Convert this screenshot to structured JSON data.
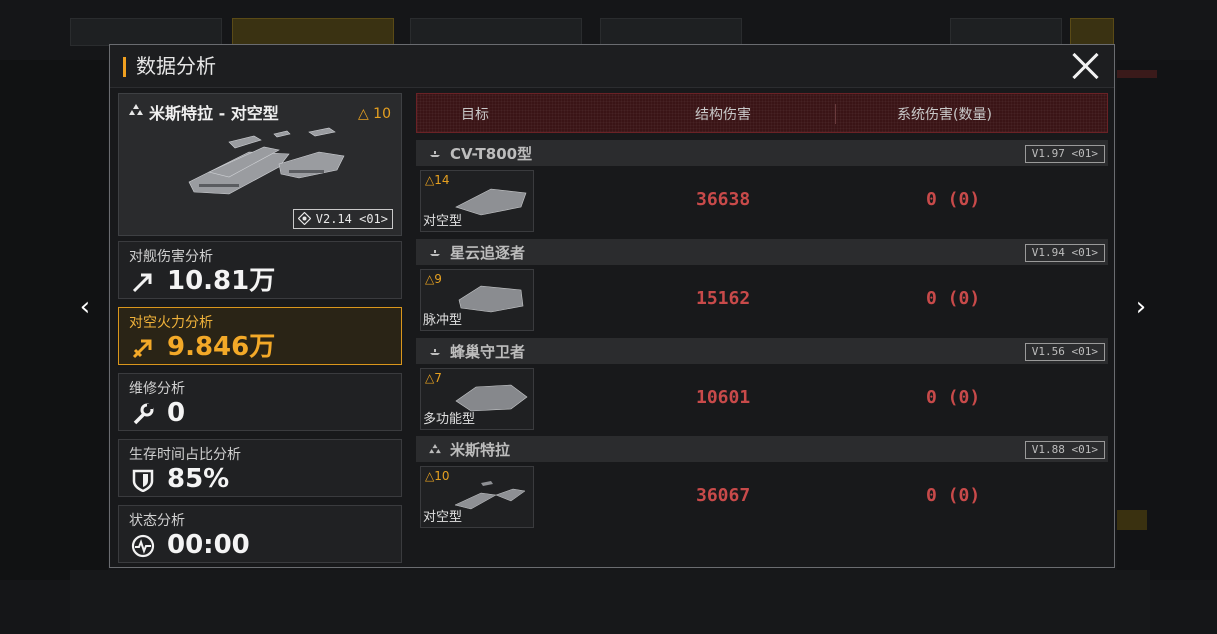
{
  "panel": {
    "title": "数据分析"
  },
  "ship": {
    "name": "米斯特拉 - 对空型",
    "tier": "△ 10",
    "version": "V2.14 <01>"
  },
  "stats": [
    {
      "label": "对舰伤害分析",
      "value": "10.81万",
      "icon": "anti-ship-arrow-icon",
      "active": false
    },
    {
      "label": "对空火力分析",
      "value": "9.846万",
      "icon": "anti-air-arrow-icon",
      "active": true
    },
    {
      "label": "维修分析",
      "value": "0",
      "icon": "wrench-icon",
      "active": false
    },
    {
      "label": "生存时间占比分析",
      "value": "85%",
      "icon": "shield-icon",
      "active": false
    },
    {
      "label": "状态分析",
      "value": "00:00",
      "icon": "pulse-icon",
      "active": false
    }
  ],
  "table": {
    "headers": [
      "目标",
      "结构伤害",
      "系统伤害(数量)"
    ],
    "rows": [
      {
        "group": "CV-T800型",
        "group_version": "V1.97 <01>",
        "tier": "△14",
        "type": "对空型",
        "structure_damage": "36638",
        "system_damage": "0 (0)"
      },
      {
        "group": "星云追逐者",
        "group_version": "V1.94 <01>",
        "tier": "△9",
        "type": "脉冲型",
        "structure_damage": "15162",
        "system_damage": "0 (0)"
      },
      {
        "group": "蜂巢守卫者",
        "group_version": "V1.56 <01>",
        "tier": "△7",
        "type": "多功能型",
        "structure_damage": "10601",
        "system_damage": "0 (0)"
      },
      {
        "group": "米斯特拉",
        "group_version": "V1.88 <01>",
        "tier": "△10",
        "type": "对空型",
        "structure_damage": "36067",
        "system_damage": "0 (0)"
      }
    ]
  },
  "nav": {
    "prev": "‹",
    "next": "›"
  },
  "colors": {
    "accent": "#f0a020",
    "damage": "#c84a4a",
    "header_red": "#3a1416"
  }
}
